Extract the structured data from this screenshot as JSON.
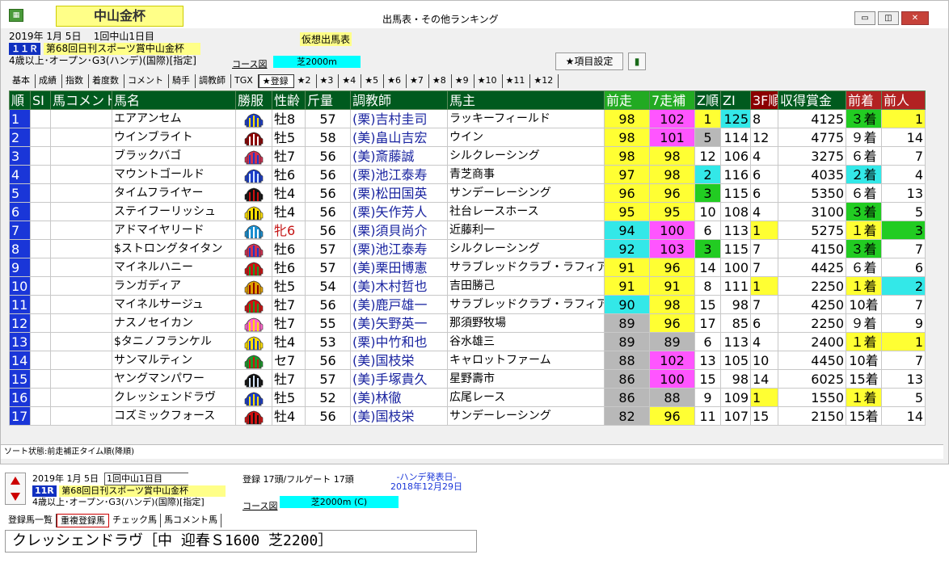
{
  "window": {
    "race_name": "中山金杯",
    "title": "出馬表・その他ランキング",
    "buttons": {
      "minimize": "▭",
      "maximize": "◫",
      "close": "✕"
    }
  },
  "race": {
    "date": "2019年  1月  5日",
    "meet": "1回中山1日目",
    "status": "仮想出馬表",
    "race_no": "１１Ｒ",
    "title": "第68回日刊スポーツ賞中山金杯",
    "conditions": "4歳以上･オープン･G3(ハンデ)(国際)[指定]",
    "course_label": "コース図",
    "course": "芝2000m"
  },
  "toolbar": {
    "items_button": "★項目設定"
  },
  "tabs": [
    {
      "label": "基本"
    },
    {
      "label": "成績"
    },
    {
      "label": "指数"
    },
    {
      "label": "着度数"
    },
    {
      "label": "コメント"
    },
    {
      "label": "騎手"
    },
    {
      "label": "調教師"
    },
    {
      "label": "TGX"
    },
    {
      "label": "★登録"
    },
    {
      "label": "★2"
    },
    {
      "label": "★3"
    },
    {
      "label": "★4"
    },
    {
      "label": "★5"
    },
    {
      "label": "★6"
    },
    {
      "label": "★7"
    },
    {
      "label": "★8"
    },
    {
      "label": "★9"
    },
    {
      "label": "★10"
    },
    {
      "label": "★11"
    },
    {
      "label": "★12"
    }
  ],
  "table": {
    "headers": [
      "順",
      "SI",
      "馬コメント",
      "馬名",
      "勝服",
      "性齢",
      "斤量",
      "調教師",
      "馬主",
      "前走",
      "7走補",
      "Z順",
      "ZI",
      "3F順",
      "収得賞金",
      "前着",
      "前人"
    ],
    "rows": [
      {
        "no": "1",
        "name": "エアアンセム",
        "sex": "牡8",
        "kin": "57",
        "trainer": "(栗)吉村圭司",
        "owner": "ラッキーフィールド",
        "zenso": "98",
        "nana": "102",
        "zjun": "1",
        "zi": "125",
        "f3": "8",
        "prize": "4125",
        "zen": "３着",
        "prev": "1"
      },
      {
        "no": "2",
        "name": "ウインブライト",
        "sex": "牡5",
        "kin": "58",
        "trainer": "(美)畠山吉宏",
        "owner": "ウイン",
        "zenso": "98",
        "nana": "101",
        "zjun": "5",
        "zi": "114",
        "f3": "12",
        "prize": "4775",
        "zen": "９着",
        "prev": "14"
      },
      {
        "no": "3",
        "name": "ブラックバゴ",
        "sex": "牡7",
        "kin": "56",
        "trainer": "(美)斎藤誠",
        "owner": "シルクレーシング",
        "zenso": "98",
        "nana": "98",
        "zjun": "12",
        "zi": "106",
        "f3": "4",
        "prize": "3275",
        "zen": "６着",
        "prev": "7"
      },
      {
        "no": "4",
        "name": "マウントゴールド",
        "sex": "牡6",
        "kin": "56",
        "trainer": "(栗)池江泰寿",
        "owner": "青芝商事",
        "zenso": "97",
        "nana": "98",
        "zjun": "2",
        "zi": "116",
        "f3": "6",
        "prize": "4035",
        "zen": "２着",
        "prev": "4"
      },
      {
        "no": "5",
        "name": "タイムフライヤー",
        "sex": "牡4",
        "kin": "56",
        "trainer": "(栗)松田国英",
        "owner": "サンデーレーシング",
        "zenso": "96",
        "nana": "96",
        "zjun": "3",
        "zi": "115",
        "f3": "6",
        "prize": "5350",
        "zen": "６着",
        "prev": "13"
      },
      {
        "no": "6",
        "name": "ステイフーリッシュ",
        "sex": "牡4",
        "kin": "56",
        "trainer": "(栗)矢作芳人",
        "owner": "社台レースホース",
        "zenso": "95",
        "nana": "95",
        "zjun": "10",
        "zi": "108",
        "f3": "4",
        "prize": "3100",
        "zen": "３着",
        "prev": "5"
      },
      {
        "no": "7",
        "name": "アドマイヤリード",
        "sex": "牝6",
        "kin": "56",
        "trainer": "(栗)須貝尚介",
        "owner": "近藤利一",
        "zenso": "94",
        "nana": "100",
        "zjun": "6",
        "zi": "113",
        "f3": "1",
        "prize": "5275",
        "zen": "１着",
        "prev": "3"
      },
      {
        "no": "8",
        "name": "$ストロングタイタン",
        "sex": "牡6",
        "kin": "57",
        "trainer": "(栗)池江泰寿",
        "owner": "シルクレーシング",
        "zenso": "92",
        "nana": "103",
        "zjun": "3",
        "zi": "115",
        "f3": "7",
        "prize": "4150",
        "zen": "３着",
        "prev": "7"
      },
      {
        "no": "9",
        "name": "マイネルハニー",
        "sex": "牡6",
        "kin": "57",
        "trainer": "(美)栗田博憲",
        "owner": "サラブレッドクラブ・ラフィアン",
        "zenso": "91",
        "nana": "96",
        "zjun": "14",
        "zi": "100",
        "f3": "7",
        "prize": "4425",
        "zen": "６着",
        "prev": "6"
      },
      {
        "no": "10",
        "name": "ランガディア",
        "sex": "牡5",
        "kin": "54",
        "trainer": "(美)木村哲也",
        "owner": "吉田勝己",
        "zenso": "91",
        "nana": "91",
        "zjun": "8",
        "zi": "111",
        "f3": "1",
        "prize": "2250",
        "zen": "１着",
        "prev": "2"
      },
      {
        "no": "11",
        "name": "マイネルサージュ",
        "sex": "牡7",
        "kin": "56",
        "trainer": "(美)鹿戸雄一",
        "owner": "サラブレッドクラブ・ラフィアン",
        "zenso": "90",
        "nana": "98",
        "zjun": "15",
        "zi": "98",
        "f3": "7",
        "prize": "4250",
        "zen": "10着",
        "prev": "7"
      },
      {
        "no": "12",
        "name": "ナスノセイカン",
        "sex": "牡7",
        "kin": "55",
        "trainer": "(美)矢野英一",
        "owner": "那須野牧場",
        "zenso": "89",
        "nana": "96",
        "zjun": "17",
        "zi": "85",
        "f3": "6",
        "prize": "2250",
        "zen": "９着",
        "prev": "9"
      },
      {
        "no": "13",
        "name": "$タニノフランケル",
        "sex": "牡4",
        "kin": "53",
        "trainer": "(栗)中竹和也",
        "owner": "谷水雄三",
        "zenso": "89",
        "nana": "89",
        "zjun": "6",
        "zi": "113",
        "f3": "4",
        "prize": "2400",
        "zen": "１着",
        "prev": "1"
      },
      {
        "no": "14",
        "name": "サンマルティン",
        "sex": "セ7",
        "kin": "56",
        "trainer": "(美)国枝栄",
        "owner": "キャロットファーム",
        "zenso": "88",
        "nana": "102",
        "zjun": "13",
        "zi": "105",
        "f3": "10",
        "prize": "4450",
        "zen": "10着",
        "prev": "7"
      },
      {
        "no": "15",
        "name": "ヤングマンパワー",
        "sex": "牡7",
        "kin": "57",
        "trainer": "(美)手塚貴久",
        "owner": "星野壽市",
        "zenso": "86",
        "nana": "100",
        "zjun": "15",
        "zi": "98",
        "f3": "14",
        "prize": "6025",
        "zen": "15着",
        "prev": "13"
      },
      {
        "no": "16",
        "name": "クレッシェンドラヴ",
        "sex": "牡5",
        "kin": "52",
        "trainer": "(美)林徹",
        "owner": "広尾レース",
        "zenso": "86",
        "nana": "88",
        "zjun": "9",
        "zi": "109",
        "f3": "1",
        "prize": "1550",
        "zen": "１着",
        "prev": "5"
      },
      {
        "no": "17",
        "name": "コズミックフォース",
        "sex": "牡4",
        "kin": "56",
        "trainer": "(美)国枝栄",
        "owner": "サンデーレーシング",
        "zenso": "82",
        "nana": "96",
        "zjun": "11",
        "zi": "107",
        "f3": "15",
        "prize": "2150",
        "zen": "15着",
        "prev": "14"
      }
    ]
  },
  "status_bar": "ソート状態:前走補正タイム順(降順)",
  "bottom": {
    "date": "2019年  1月  5日",
    "meet": "1回中山1日目",
    "entries": "登録 17頭/フルゲート 17頭",
    "handicap_label": "-ハンデ発表日-",
    "handicap_date": "2018年12月29日",
    "race_no": "11R",
    "title": "第68回日刊スポーツ賞中山金杯",
    "conditions": "4歳以上･オープン･G3(ハンデ)(国際)[指定]",
    "course_label": "コース図",
    "course": "芝2000m (C)",
    "tabs": [
      {
        "label": "登録馬一覧"
      },
      {
        "label": "重複登録馬"
      },
      {
        "label": "チェック馬"
      },
      {
        "label": "馬コメント馬"
      }
    ],
    "comment": "クレッシェンドラヴ［中 迎春Ｓ1600  芝2200］"
  }
}
